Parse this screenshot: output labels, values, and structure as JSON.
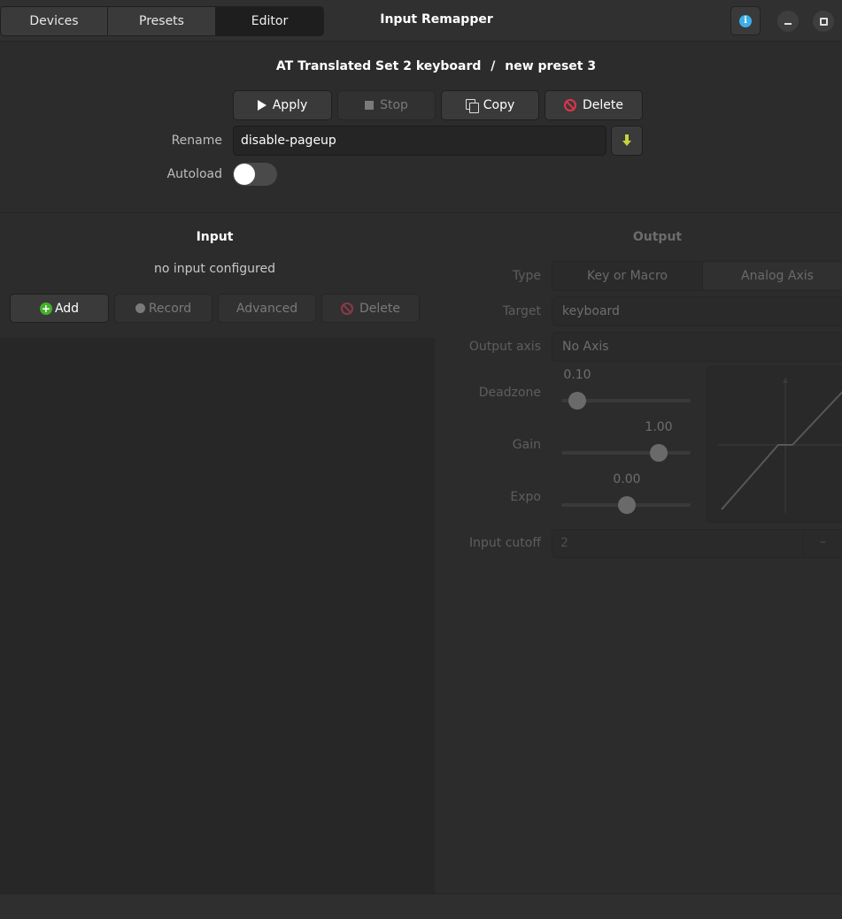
{
  "header": {
    "tabs": [
      {
        "label": "Devices"
      },
      {
        "label": "Presets"
      },
      {
        "label": "Editor"
      }
    ],
    "active_tab": "Editor",
    "title": "Input Remapper",
    "info_icon": "info-icon",
    "info_color": "#3daee9"
  },
  "preset": {
    "device": "AT Translated Set 2 keyboard",
    "separator": "/",
    "name": "new preset 3",
    "actions": {
      "apply": "Apply",
      "stop": "Stop",
      "copy": "Copy",
      "delete": "Delete"
    },
    "rename_label": "Rename",
    "rename_value": "disable-pageup",
    "autoload_label": "Autoload",
    "autoload_enabled": false,
    "delete_color": "#e0344c"
  },
  "input_panel": {
    "heading": "Input",
    "status": "no input configured",
    "buttons": {
      "add": "Add",
      "record": "Record",
      "advanced": "Advanced",
      "delete": "Delete"
    },
    "add_color": "#43b02a"
  },
  "output_panel": {
    "heading": "Output",
    "type_label": "Type",
    "type_options": [
      "Key or Macro",
      "Analog Axis"
    ],
    "selected_type": "Key or Macro",
    "target_label": "Target",
    "target_value": "keyboard",
    "output_axis_label": "Output axis",
    "output_axis_value": "No Axis",
    "deadzone_label": "Deadzone",
    "deadzone_value": "0.10",
    "gain_label": "Gain",
    "gain_value": "1.00",
    "expo_label": "Expo",
    "expo_value": "0.00",
    "input_cutoff_label": "Input cutoff",
    "input_cutoff_value": "2",
    "input_cutoff_minus": "–"
  }
}
